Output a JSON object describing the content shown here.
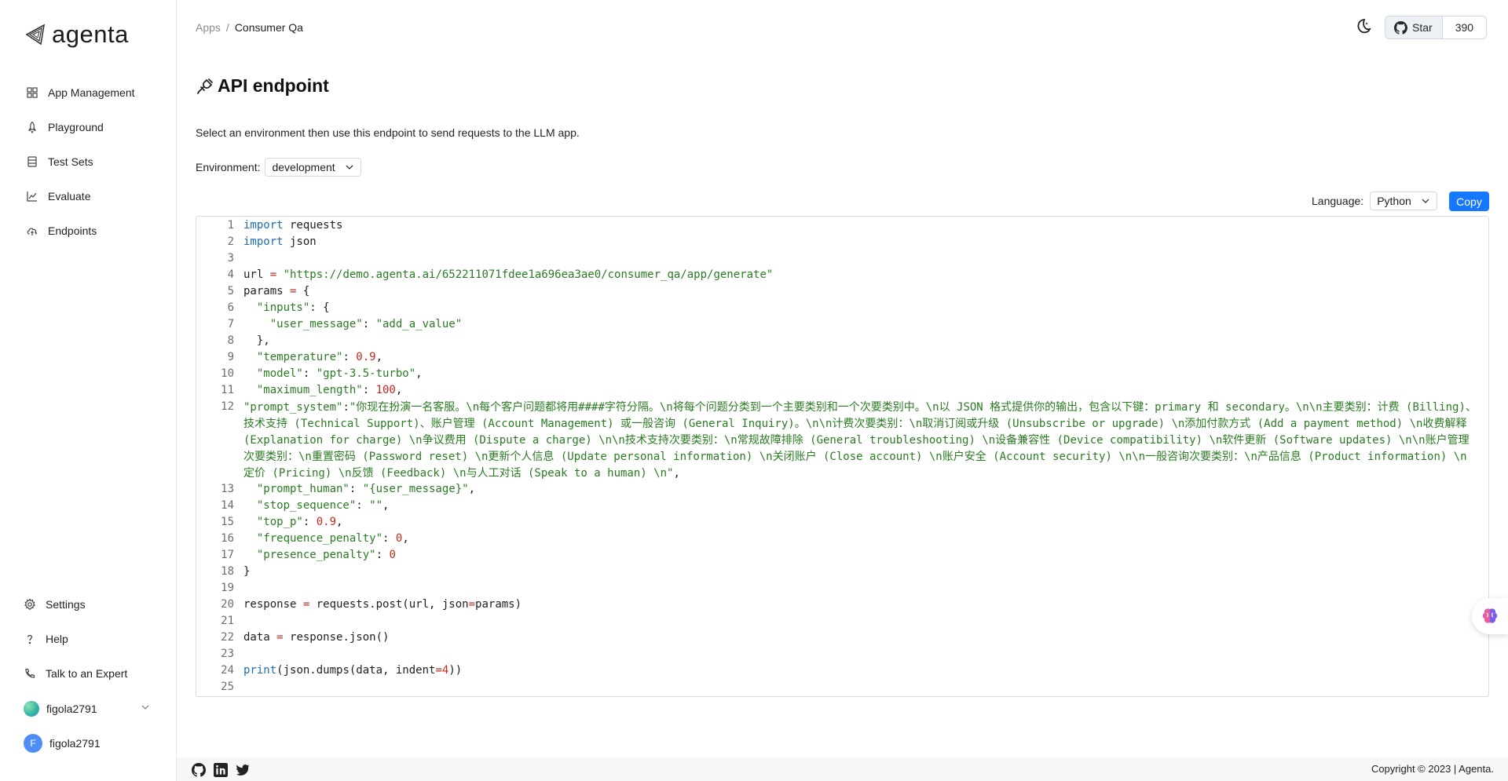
{
  "app": {
    "logo_text": "agenta"
  },
  "sidebar": {
    "items": [
      {
        "label": "App Management",
        "icon": "grid-icon"
      },
      {
        "label": "Playground",
        "icon": "rocket-icon"
      },
      {
        "label": "Test Sets",
        "icon": "database-icon"
      },
      {
        "label": "Evaluate",
        "icon": "chart-line-icon"
      },
      {
        "label": "Endpoints",
        "icon": "cloud-upload-icon"
      }
    ],
    "bottom_items": [
      {
        "label": "Settings",
        "icon": "gear-icon"
      },
      {
        "label": "Help",
        "icon": "question-icon"
      },
      {
        "label": "Talk to an Expert",
        "icon": "phone-icon"
      }
    ],
    "workspace": {
      "name": "figola2791"
    },
    "user": {
      "name": "figola2791",
      "initial": "F"
    }
  },
  "header": {
    "breadcrumb": {
      "root": "Apps",
      "separator": "/",
      "current": "Consumer Qa"
    },
    "github": {
      "star_label": "Star",
      "star_count": "390"
    }
  },
  "main": {
    "title": "API endpoint",
    "description": "Select an environment then use this endpoint to send requests to the LLM app.",
    "environment": {
      "label": "Environment:",
      "value": "development"
    },
    "language": {
      "label": "Language:",
      "value": "Python"
    },
    "copy_label": "Copy",
    "code": {
      "line_numbers": [
        "1",
        "2",
        "3",
        "4",
        "5",
        "6",
        "7",
        "8",
        "9",
        "10",
        "11",
        "12",
        "13",
        "14",
        "15",
        "16",
        "17",
        "18",
        "19",
        "20",
        "21",
        "22",
        "23",
        "24",
        "25"
      ],
      "lines": {
        "l1_kw": "import",
        "l1_rest": " requests",
        "l2_kw": "import",
        "l2_rest": " json",
        "l4_var": "url ",
        "l4_op": "=",
        "l4_str": " \"https://demo.agenta.ai/652211071fdee1a696ea3ae0/consumer_qa/app/generate\"",
        "l5_var": "params ",
        "l5_op": "=",
        "l5_rest": " {",
        "l6_str": "  \"inputs\"",
        "l6_rest": ": {",
        "l7_str": "    \"user_message\"",
        "l7_rest": ": ",
        "l7_val": "\"add_a_value\"",
        "l8": "  },",
        "l9_str": "  \"temperature\"",
        "l9_rest": ": ",
        "l9_num": "0.9",
        "l9_end": ",",
        "l10_str": "  \"model\"",
        "l10_rest": ": ",
        "l10_val": "\"gpt-3.5-turbo\"",
        "l10_end": ",",
        "l11_str": "  \"maximum_length\"",
        "l11_rest": ": ",
        "l11_num": "100",
        "l11_end": ",",
        "l12_key": " \"prompt_system\"",
        "l12_colon": ":",
        "l12_val": "\"你现在扮演一名客服。\\n每个客户问题都将用####字符分隔。\\n将每个问题分类到一个主要类别和一个次要类别中。\\n以 JSON 格式提供你的输出，包含以下键：primary 和 secondary。\\n\\n主要类别：计费 (Billing)、技术支持 (Technical Support)、账户管理 (Account Management) 或一般咨询 (General Inquiry)。\\n\\n计费次要类别：\\n取消订阅或升级 (Unsubscribe or upgrade) \\n添加付款方式 (Add a payment method) \\n收费解释 (Explanation for charge) \\n争议费用 (Dispute a charge) \\n\\n技术支持次要类别：\\n常规故障排除 (General troubleshooting) \\n设备兼容性 (Device compatibility) \\n软件更新 (Software updates) \\n\\n账户管理次要类别：\\n重置密码 (Password reset) \\n更新个人信息 (Update personal information) \\n关闭账户 (Close account) \\n账户安全 (Account security) \\n\\n一般咨询次要类别：\\n产品信息 (Product information) \\n定价 (Pricing) \\n反馈 (Feedback) \\n与人工对话 (Speak to a human) \\n\"",
        "l12_end": ",",
        "l13_str": "  \"prompt_human\"",
        "l13_rest": ": ",
        "l13_val": "\"{user_message}\"",
        "l13_end": ",",
        "l14_str": "  \"stop_sequence\"",
        "l14_rest": ": ",
        "l14_val": "\"\"",
        "l14_end": ",",
        "l15_str": "  \"top_p\"",
        "l15_rest": ": ",
        "l15_num": "0.9",
        "l15_end": ",",
        "l16_str": "  \"frequence_penalty\"",
        "l16_rest": ": ",
        "l16_num": "0",
        "l16_end": ",",
        "l17_str": "  \"presence_penalty\"",
        "l17_rest": ": ",
        "l17_num": "0",
        "l18": "}",
        "l20_a": "response ",
        "l20_op": "=",
        "l20_b": " requests.post(url, json",
        "l20_op2": "=",
        "l20_c": "params)",
        "l22_a": "data ",
        "l22_op": "=",
        "l22_b": " response.json()",
        "l24_fn": "print",
        "l24_a": "(json.dumps(data, indent",
        "l24_op": "=",
        "l24_num": "4",
        "l24_b": "))"
      }
    }
  },
  "footer": {
    "copyright": "Copyright © 2023 | Agenta."
  },
  "colors": {
    "accent": "#1677ff",
    "keyword": "#1f6fb2",
    "string": "#2a7b22",
    "number": "#c4291c"
  }
}
